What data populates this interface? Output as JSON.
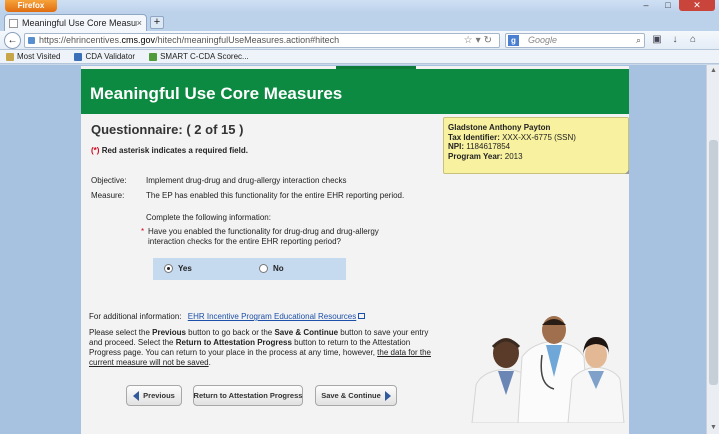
{
  "browser": {
    "menu_button": "Firefox",
    "tab_title": "Meaningful Use Core Measures - EHR In...",
    "tab_close": "×",
    "new_tab": "+",
    "url_prefix": "https://ehrincentives.",
    "url_domain": "cms.gov",
    "url_path": "/hitech/meaningfulUseMeasures.action#hitech",
    "search_placeholder": "Google",
    "bookmarks": [
      "Most Visited",
      "CDA Validator",
      "SMART C-CDA Scorec..."
    ]
  },
  "page": {
    "header": "Meaningful Use Core Measures",
    "questionnaire": "Questionnaire: ( 2 of 15 )",
    "required_asterisk": "(*)",
    "required_note": "Red asterisk indicates a required field.",
    "objective_label": "Objective:",
    "objective_text": "Implement drug-drug and drug-allergy interaction checks",
    "measure_label": "Measure:",
    "measure_text": "The EP has enabled this functionality for the entire EHR reporting period.",
    "instruction": "Complete the following information:",
    "question_star": "*",
    "question": "Have you enabled the functionality for drug-drug and drug-allergy interaction checks for the entire EHR reporting period?",
    "answers": [
      {
        "label": "Yes",
        "selected": true
      },
      {
        "label": "No",
        "selected": false
      }
    ],
    "additional_label": "For additional information:",
    "additional_link": "EHR Incentive Program Educational Resources",
    "para_1": "Please select the ",
    "para_previous": "Previous",
    "para_2": " button to go back or the ",
    "para_save": "Save & Continue",
    "para_3": " button to save your entry and proceed. Select the ",
    "para_return": "Return to Attestation Progress",
    "para_4": " button to return to the Attestation Progress page. You can return to your place in the process at any time, however, ",
    "para_underline": "the data for the current measure will not be saved",
    "para_5": ".",
    "buttons": {
      "previous": "Previous",
      "return": "Return to Attestation Progress",
      "save": "Save & Continue"
    }
  },
  "provider": {
    "name": "Gladstone Anthony Payton",
    "tax_label": "Tax Identifier:",
    "tax_value": "XXX-XX-6775 (SSN)",
    "npi_label": "NPI:",
    "npi_value": "1184617854",
    "year_label": "Program Year:",
    "year_value": "2013"
  },
  "colors": {
    "header_green": "#0c8a42",
    "required_red": "#d0021b",
    "link_blue": "#1b4fa8",
    "infobox_yellow": "#f7f1a0"
  }
}
